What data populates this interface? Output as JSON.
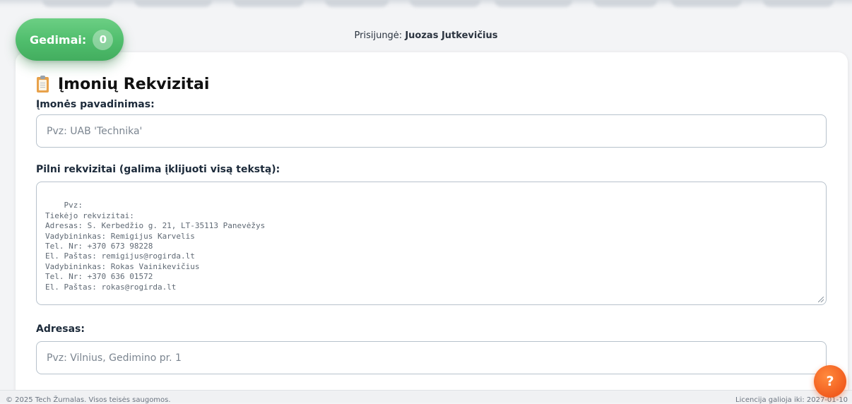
{
  "header": {
    "faults_label": "Gedimai:",
    "faults_count": "0",
    "login_prefix": "Prisijungė:",
    "login_user": "Juozas Jutkevičius"
  },
  "form": {
    "title": "Įmonių Rekvizitai",
    "company_name": {
      "label": "Įmonės pavadinimas:",
      "placeholder": "Pvz: UAB 'Technika'"
    },
    "full_details": {
      "label": "Pilni rekvizitai (galima įklijuoti visą tekstą):",
      "placeholder": "Pvz:\nTiekėjo rekvizitai:\nAdresas: S. Kerbedžio g. 21, LT-35113 Panevėžys\nVadybininkas: Remigijus Karvelis\nTel. Nr: +370 673 98228\nEl. Paštas: remigijus@rogirda.lt\nVadybininkas: Rokas Vainikevičius\nTel. Nr: +370 636 01572\nEl. Paštas: rokas@rogirda.lt"
    },
    "address": {
      "label": "Adresas:",
      "placeholder": "Pvz: Vilnius, Gedimino pr. 1"
    }
  },
  "footer": {
    "copyright": "© 2025 Tech Žurnalas. Visos teisės saugomos.",
    "license": "Licencija galioja iki: 2027-01-10"
  },
  "help_button": {
    "label": "?"
  },
  "colors": {
    "faults_green": "#4fbd6c",
    "help_orange": "#f25c1e",
    "border": "#b7c2cc"
  }
}
